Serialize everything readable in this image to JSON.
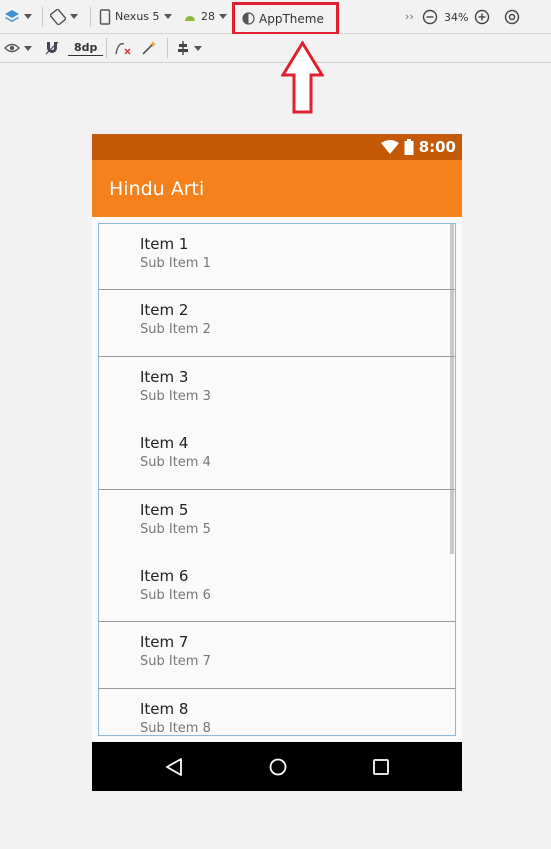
{
  "toolbar": {
    "device_label": "Nexus 5",
    "api_level": "28",
    "theme_label": "AppTheme",
    "zoom_label": "34%",
    "margin_label": "8dp",
    "more_label": "››"
  },
  "status_bar": {
    "time": "8:00"
  },
  "app": {
    "title": "Hindu Arti"
  },
  "list": {
    "items": [
      {
        "title": "Item 1",
        "subtitle": "Sub Item 1"
      },
      {
        "title": "Item 2",
        "subtitle": "Sub Item 2"
      },
      {
        "title": "Item 3",
        "subtitle": "Sub Item 3"
      },
      {
        "title": "Item 4",
        "subtitle": "Sub Item 4"
      },
      {
        "title": "Item 5",
        "subtitle": "Sub Item 5"
      },
      {
        "title": "Item 6",
        "subtitle": "Sub Item 6"
      },
      {
        "title": "Item 7",
        "subtitle": "Sub Item 7"
      },
      {
        "title": "Item 8",
        "subtitle": "Sub Item 8"
      }
    ]
  },
  "colors": {
    "status_bar": "#c45a08",
    "app_bar": "#f5811d",
    "highlight": "#e02030"
  },
  "icons": {
    "layers": "layers-icon",
    "rotate": "rotate-icon",
    "device": "phone-icon",
    "android": "android-icon",
    "theme": "theme-icon",
    "zoom_out": "zoom-out-icon",
    "zoom_in": "zoom-in-icon",
    "zoom_fit": "zoom-fit-icon",
    "eye": "eye-icon",
    "magnet": "magnet-icon",
    "constraints": "clear-constraints-icon",
    "magic": "magic-wand-icon",
    "align": "align-icon",
    "wifi": "wifi-icon",
    "battery": "battery-icon",
    "back": "back-icon",
    "home": "home-icon",
    "recents": "recents-icon"
  }
}
